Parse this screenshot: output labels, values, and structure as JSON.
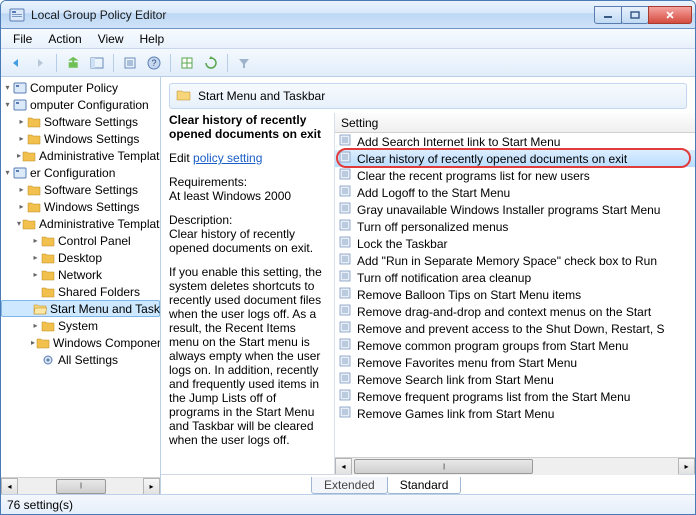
{
  "window": {
    "title": "Local Group Policy Editor"
  },
  "menu": {
    "file": "File",
    "action": "Action",
    "view": "View",
    "help": "Help"
  },
  "tree": {
    "nodes": [
      {
        "label": "Computer Policy",
        "indent": 0,
        "exp": "▾",
        "icon": "policy"
      },
      {
        "label": "omputer Configuration",
        "indent": 0,
        "exp": "▾",
        "icon": "policy"
      },
      {
        "label": "Software Settings",
        "indent": 1,
        "exp": "▸",
        "icon": "folder"
      },
      {
        "label": "Windows Settings",
        "indent": 1,
        "exp": "▸",
        "icon": "folder"
      },
      {
        "label": "Administrative Templates",
        "indent": 1,
        "exp": "▸",
        "icon": "folder"
      },
      {
        "label": "er Configuration",
        "indent": 0,
        "exp": "▾",
        "icon": "policy"
      },
      {
        "label": "Software Settings",
        "indent": 1,
        "exp": "▸",
        "icon": "folder"
      },
      {
        "label": "Windows Settings",
        "indent": 1,
        "exp": "▸",
        "icon": "folder"
      },
      {
        "label": "Administrative Templates",
        "indent": 1,
        "exp": "▾",
        "icon": "folder"
      },
      {
        "label": "Control Panel",
        "indent": 2,
        "exp": "▸",
        "icon": "folder"
      },
      {
        "label": "Desktop",
        "indent": 2,
        "exp": "▸",
        "icon": "folder"
      },
      {
        "label": "Network",
        "indent": 2,
        "exp": "▸",
        "icon": "folder"
      },
      {
        "label": "Shared Folders",
        "indent": 2,
        "exp": "",
        "icon": "folder"
      },
      {
        "label": "Start Menu and Taskbar",
        "indent": 2,
        "exp": "",
        "icon": "folder-open",
        "selected": true
      },
      {
        "label": "System",
        "indent": 2,
        "exp": "▸",
        "icon": "folder"
      },
      {
        "label": "Windows Components",
        "indent": 2,
        "exp": "▸",
        "icon": "folder"
      },
      {
        "label": "All Settings",
        "indent": 2,
        "exp": "",
        "icon": "settings"
      }
    ]
  },
  "detail": {
    "header": "Start Menu and Taskbar",
    "policy_title": "Clear history of recently opened documents on exit",
    "edit_label": "Edit ",
    "edit_link": "policy setting",
    "req_label": "Requirements:",
    "req_text": "At least Windows 2000",
    "desc_label": "Description:",
    "desc_text": "Clear history of recently opened documents on exit.",
    "desc_long": "If you enable this setting, the system deletes shortcuts to recently used document files when the user logs off. As a result, the Recent Items menu on the Start menu is always empty when the user logs on. In addition, recently and frequently used items in the Jump Lists off of programs in the Start Menu and Taskbar will be cleared when the user logs off."
  },
  "list": {
    "header": "Setting",
    "items": [
      "Add Search Internet link to Start Menu",
      "Clear history of recently opened documents on exit",
      "Clear the recent programs list for new users",
      "Add Logoff to the Start Menu",
      "Gray unavailable Windows Installer programs Start Menu",
      "Turn off personalized menus",
      "Lock the Taskbar",
      "Add \"Run in Separate Memory Space\" check box to Run",
      "Turn off notification area cleanup",
      "Remove Balloon Tips on Start Menu items",
      "Remove drag-and-drop and context menus on the Start",
      "Remove and prevent access to the Shut Down, Restart, S",
      "Remove common program groups from Start Menu",
      "Remove Favorites menu from Start Menu",
      "Remove Search link from Start Menu",
      "Remove frequent programs list from the Start Menu",
      "Remove Games link from Start Menu"
    ],
    "highlighted_index": 1
  },
  "tabs": {
    "extended": "Extended",
    "standard": "Standard"
  },
  "status": {
    "text": "76 setting(s)"
  }
}
